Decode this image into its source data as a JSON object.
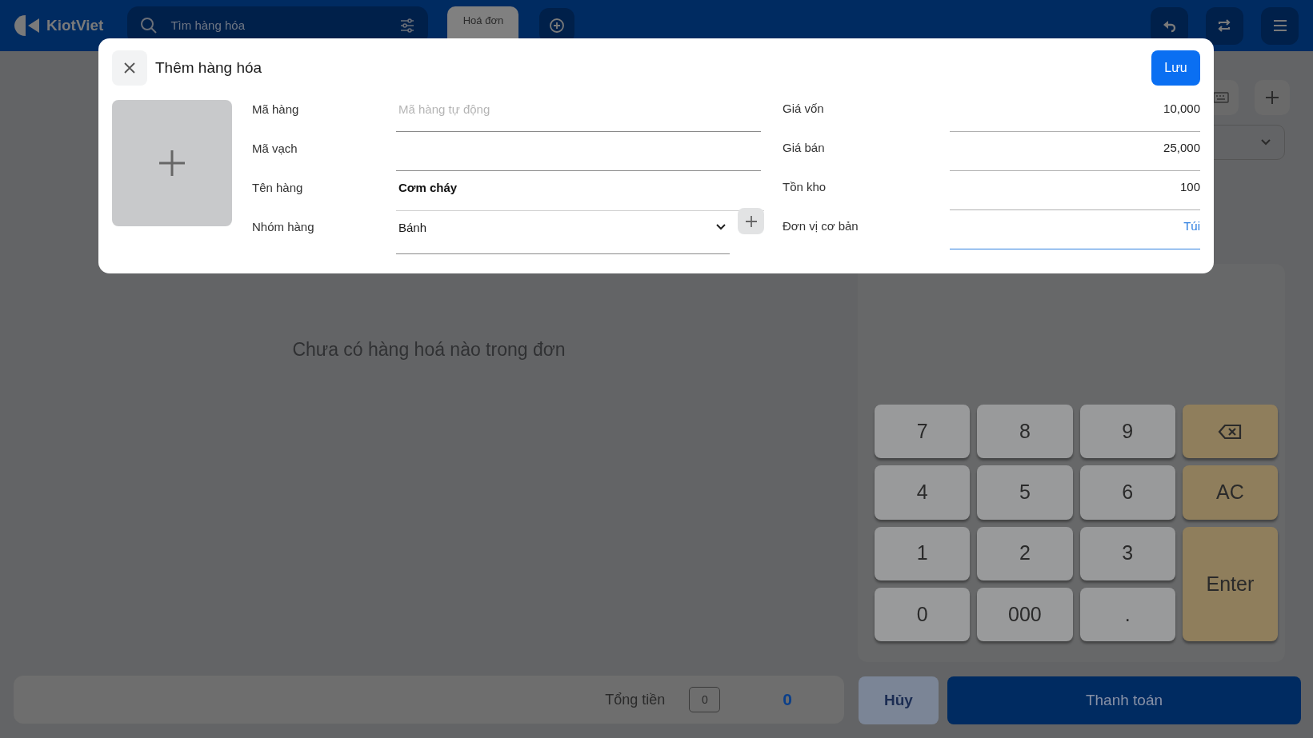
{
  "top_bar": {
    "logo": "KiotViet",
    "search": {
      "placeholder": "Tìm hàng hóa"
    },
    "tabs": [
      {
        "label": "Hoá đơn",
        "selected": true
      }
    ]
  },
  "order": {
    "empty_message": "Chưa có hàng hoá nào trong đơn"
  },
  "keypad": [
    {
      "kind": "digit",
      "label": "7"
    },
    {
      "kind": "digit",
      "label": "8"
    },
    {
      "kind": "digit",
      "label": "9"
    },
    {
      "kind": "backspace"
    },
    {
      "kind": "digit",
      "label": "4"
    },
    {
      "kind": "digit",
      "label": "5"
    },
    {
      "kind": "digit",
      "label": "6"
    },
    {
      "kind": "action",
      "label": "AC"
    },
    {
      "kind": "digit",
      "label": "1"
    },
    {
      "kind": "digit",
      "label": "2"
    },
    {
      "kind": "digit",
      "label": "3"
    },
    {
      "kind": "enter",
      "label": "Enter"
    },
    {
      "kind": "digit",
      "label": "0"
    },
    {
      "kind": "digit",
      "label": "000"
    },
    {
      "kind": "digit",
      "label": "."
    }
  ],
  "footer": {
    "total_label": "Tổng tiền",
    "quantity": "0",
    "total": "0",
    "cancel": "Hủy",
    "pay": "Thanh toán"
  },
  "dialog": {
    "title": "Thêm hàng hóa",
    "save": "Lưu",
    "left_fields": [
      {
        "kind": "text",
        "label": "Mã hàng",
        "placeholder": "Mã hàng tự động"
      },
      {
        "kind": "text",
        "label": "Mã vạch"
      },
      {
        "kind": "text",
        "label": "Tên hàng",
        "value": "Cơm cháy"
      },
      {
        "kind": "select",
        "label": "Nhóm hàng",
        "value": "Bánh"
      }
    ],
    "right_fields": [
      {
        "label": "Giá vốn",
        "value": "10,000",
        "focused": false
      },
      {
        "label": "Giá bán",
        "value": "25,000",
        "focused": false
      },
      {
        "label": "Tồn kho",
        "value": "100",
        "focused": false
      },
      {
        "label": "Đơn vị cơ bản",
        "value": "Túi",
        "focused": true
      }
    ]
  }
}
